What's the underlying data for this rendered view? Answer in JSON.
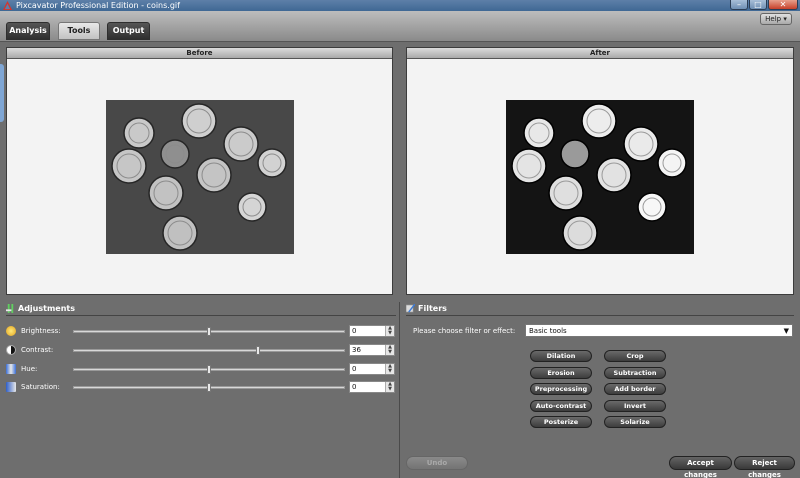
{
  "window": {
    "title": "Pixcavator Professional Edition - coins.gif"
  },
  "tabs": [
    {
      "label": "Analysis",
      "active": false
    },
    {
      "label": "Tools",
      "active": true
    },
    {
      "label": "Output",
      "active": false
    }
  ],
  "help": {
    "label": "Help ▾"
  },
  "panels": {
    "before_title": "Before",
    "after_title": "After"
  },
  "adjustments": {
    "title": "Adjustments",
    "rows": [
      {
        "label": "Brightness:",
        "value": "0",
        "fraction": 0.5,
        "icon": "sun-icon"
      },
      {
        "label": "Contrast:",
        "value": "36",
        "fraction": 0.68,
        "icon": "contrast-icon"
      },
      {
        "label": "Hue:",
        "value": "0",
        "fraction": 0.5,
        "icon": "hue-icon"
      },
      {
        "label": "Saturation:",
        "value": "0",
        "fraction": 0.5,
        "icon": "saturation-icon"
      }
    ]
  },
  "filters": {
    "title": "Filters",
    "prompt": "Please choose filter or effect:",
    "selected": "Basic tools",
    "buttons": [
      [
        "Dilation",
        "Crop"
      ],
      [
        "Erosion",
        "Subtraction"
      ],
      [
        "Preprocessing",
        "Add border"
      ],
      [
        "Auto-contrast",
        "Invert"
      ],
      [
        "Posterize",
        "Solarize"
      ]
    ]
  },
  "bottom": {
    "undo": "Undo",
    "accept": "Accept changes",
    "reject": "Reject changes"
  },
  "colors": {
    "titlebar": "#4a6f9c",
    "panel_bg": "#f3f3f3",
    "workspace": "#6e6e6e",
    "button": "#4a4a4a"
  }
}
